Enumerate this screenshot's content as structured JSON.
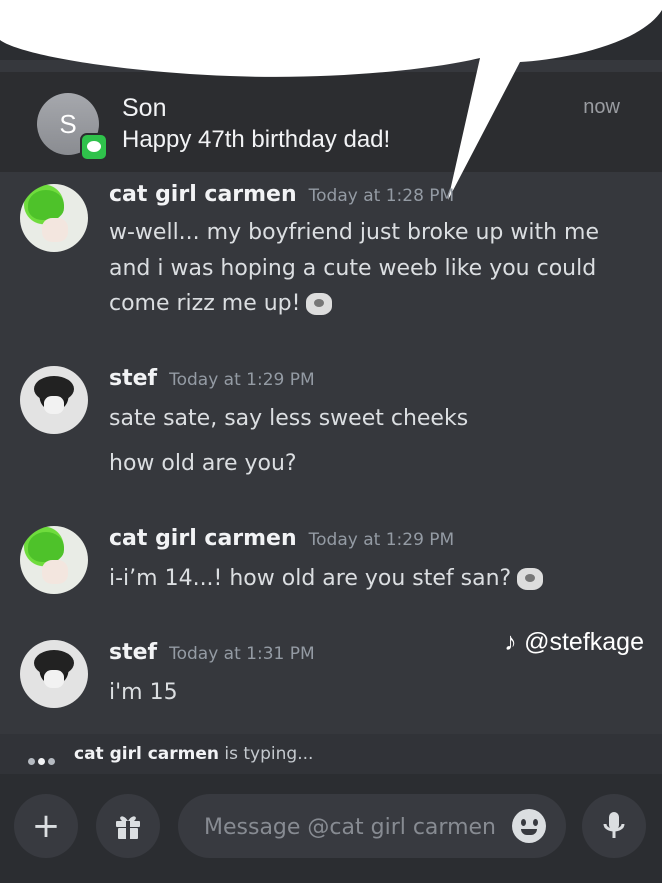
{
  "notification": {
    "avatar_initial": "S",
    "sender": "Son",
    "text": "Happy 47th birthday dad!",
    "time": "now",
    "app_icon": "messages-icon"
  },
  "messages": [
    {
      "username": "cat girl carmen",
      "timestamp": "Today at 1:28 PM",
      "avatar": "carmen-avatar",
      "lines": [
        "w-well... my boyfriend just broke up with me",
        "and i was hoping a cute weeb like you could",
        "come rizz me up!"
      ],
      "sticker": "anime-sticker"
    },
    {
      "username": "stef",
      "timestamp": "Today at 1:29 PM",
      "avatar": "stef-avatar",
      "lines": [
        "sate sate, say less sweet cheeks",
        "how old are you?"
      ]
    },
    {
      "username": "cat girl carmen",
      "timestamp": "Today at 1:29 PM",
      "avatar": "carmen-avatar",
      "lines": [
        "i-i’m 14...! how old are you stef san?"
      ],
      "sticker": "anime-sticker"
    },
    {
      "username": "stef",
      "timestamp": "Today at 1:31 PM",
      "avatar": "stef-avatar",
      "lines": [
        "i'm 15"
      ]
    }
  ],
  "watermark": {
    "icon": "tiktok-icon",
    "glyph": "♪",
    "handle": "@stefkage"
  },
  "typing": {
    "name": "cat girl carmen",
    "suffix": "is typing..."
  },
  "input": {
    "placeholder": "Message @cat girl carmen",
    "plus_icon": "+",
    "gift_icon": "gift-icon",
    "emoji_icon": "smile-icon",
    "mic_icon": "mic-icon"
  },
  "colors": {
    "background": "#36383d",
    "input_bar": "#2b2d31",
    "username": "#f2f3f5",
    "timestamp": "#949ba4"
  }
}
